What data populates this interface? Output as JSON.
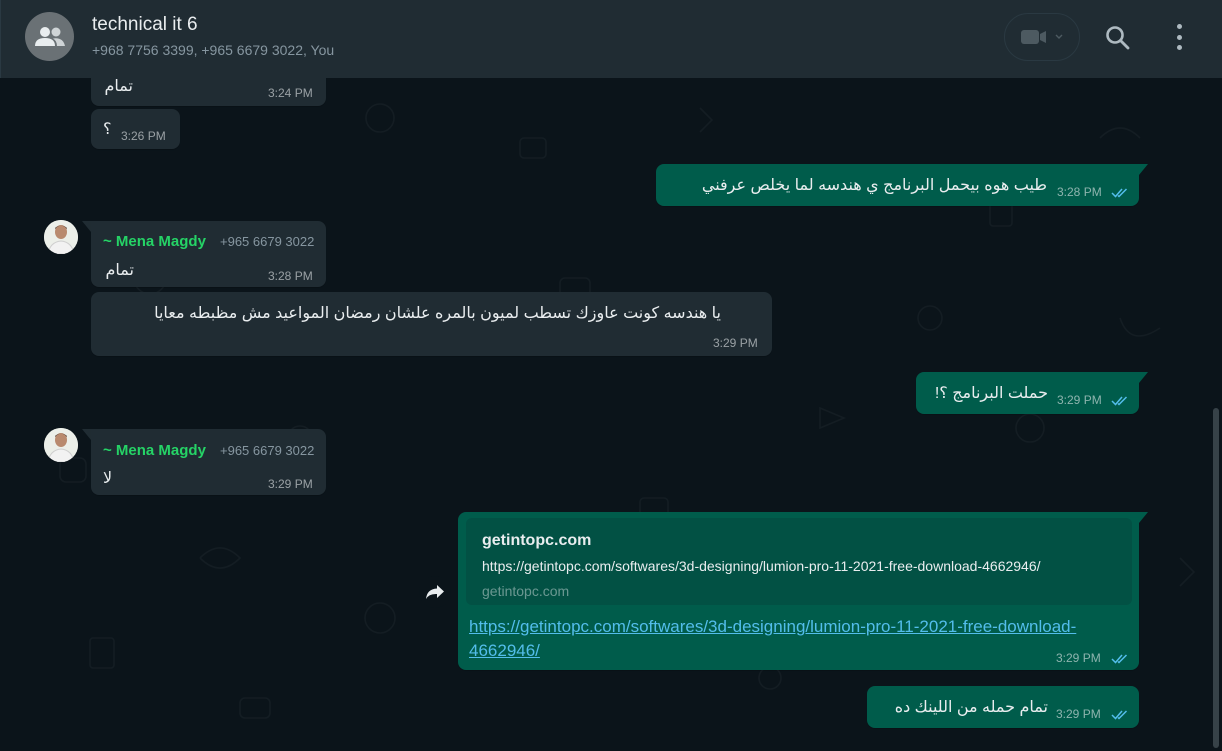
{
  "header": {
    "title": "technical it 6",
    "participants": "+968 7756 3399, +965 6679 3022, You"
  },
  "messages": {
    "m1": {
      "text": "تمام",
      "time": "3:24 PM"
    },
    "m2": {
      "text": "؟",
      "time": "3:26 PM"
    },
    "m3": {
      "text": "طيب هوه بيحمل البرنامج ي هندسه لما يخلص عرفني",
      "time": "3:28 PM"
    },
    "m4": {
      "sender": "~ Mena Magdy",
      "phone": "+965 6679 3022",
      "text": "تمام",
      "time": "3:28 PM"
    },
    "m5": {
      "text": "يا هندسه كونت عاوزك تسطب لميون بالمره علشان رمضان المواعيد مش مظبطه معايا",
      "time": "3:29 PM"
    },
    "m6": {
      "text": "حملت البرنامج ؟!",
      "time": "3:29 PM"
    },
    "m7": {
      "sender": "~ Mena Magdy",
      "phone": "+965 6679 3022",
      "text": "لا",
      "time": "3:29 PM"
    },
    "m8": {
      "preview_title": "getintopc.com",
      "preview_desc": "https://getintopc.com/softwares/3d-designing/lumion-pro-11-2021-free-download-4662946/",
      "preview_domain": "getintopc.com",
      "url_line1": "https://getintopc.com/softwares/3d-designing/lumion-pro-11-2021-free-download-",
      "url_line2": "4662946/",
      "time": "3:29 PM"
    },
    "m9": {
      "text": "تمام حمله من اللينك ده",
      "time": "3:29 PM"
    }
  },
  "colors": {
    "background": "#0b141a",
    "header": "#202c33",
    "incoming": "#202c33",
    "outgoing": "#005c4b",
    "sender_name": "#25d366",
    "link": "#53bdeb",
    "read_ticks": "#53bdeb"
  },
  "icons": [
    "group-avatar-icon",
    "video-call-icon",
    "chevron-down-icon",
    "search-icon",
    "menu-icon",
    "double-check-icon",
    "forward-icon"
  ]
}
